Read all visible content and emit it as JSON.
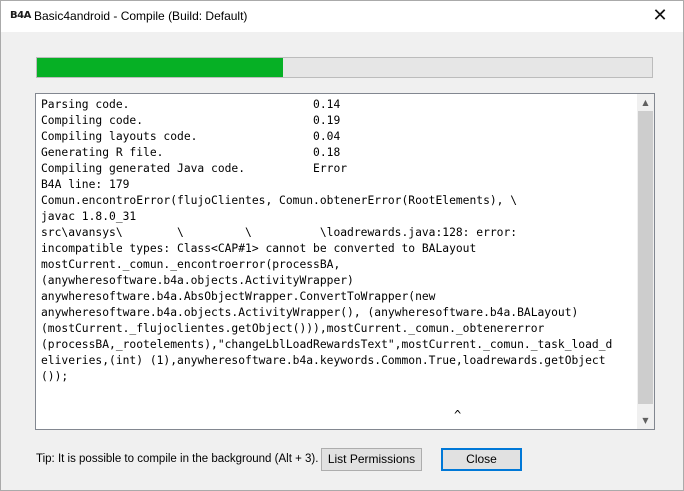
{
  "window": {
    "app_logo": "B4A",
    "title": "Basic4android - Compile (Build: Default)",
    "close_glyph": "✕"
  },
  "progress": {
    "fraction": 0.4,
    "color": "#06b025"
  },
  "log": {
    "text": "Parsing code.                           0.14\nCompiling code.                         0.19\nCompiling layouts code.                 0.04\nGenerating R file.                      0.18\nCompiling generated Java code.          Error\nB4A line: 179\nComun.encontroError(flujoClientes, Comun.obtenerError(RootElements), \\\njavac 1.8.0_31\nsrc\\avansys\\        \\         \\          \\loadrewards.java:128: error:\nincompatible types: Class<CAP#1> cannot be converted to BALayout\nmostCurrent._comun._encontroerror(processBA,\n(anywheresoftware.b4a.objects.ActivityWrapper)\nanywheresoftware.b4a.AbsObjectWrapper.ConvertToWrapper(new\nanywheresoftware.b4a.objects.ActivityWrapper(), (anywheresoftware.b4a.BALayout)\n(mostCurrent._flujoclientes.getObject())),mostCurrent._comun._obtenererror\n(processBA,_rootelements),\"changeLblLoadRewardsText\",mostCurrent._comun._task_load_d\neliveries,(int) (1),anywheresoftware.b4a.keywords.Common.True,loadrewards.getObject\n());",
    "caret": "^"
  },
  "scrollbar": {
    "up_arrow": "▲",
    "down_arrow": "▼"
  },
  "footer": {
    "tip": "Tip: It is possible to compile in the background (Alt + 3).",
    "list_permissions_label": "List Permissions",
    "close_label": "Close"
  }
}
